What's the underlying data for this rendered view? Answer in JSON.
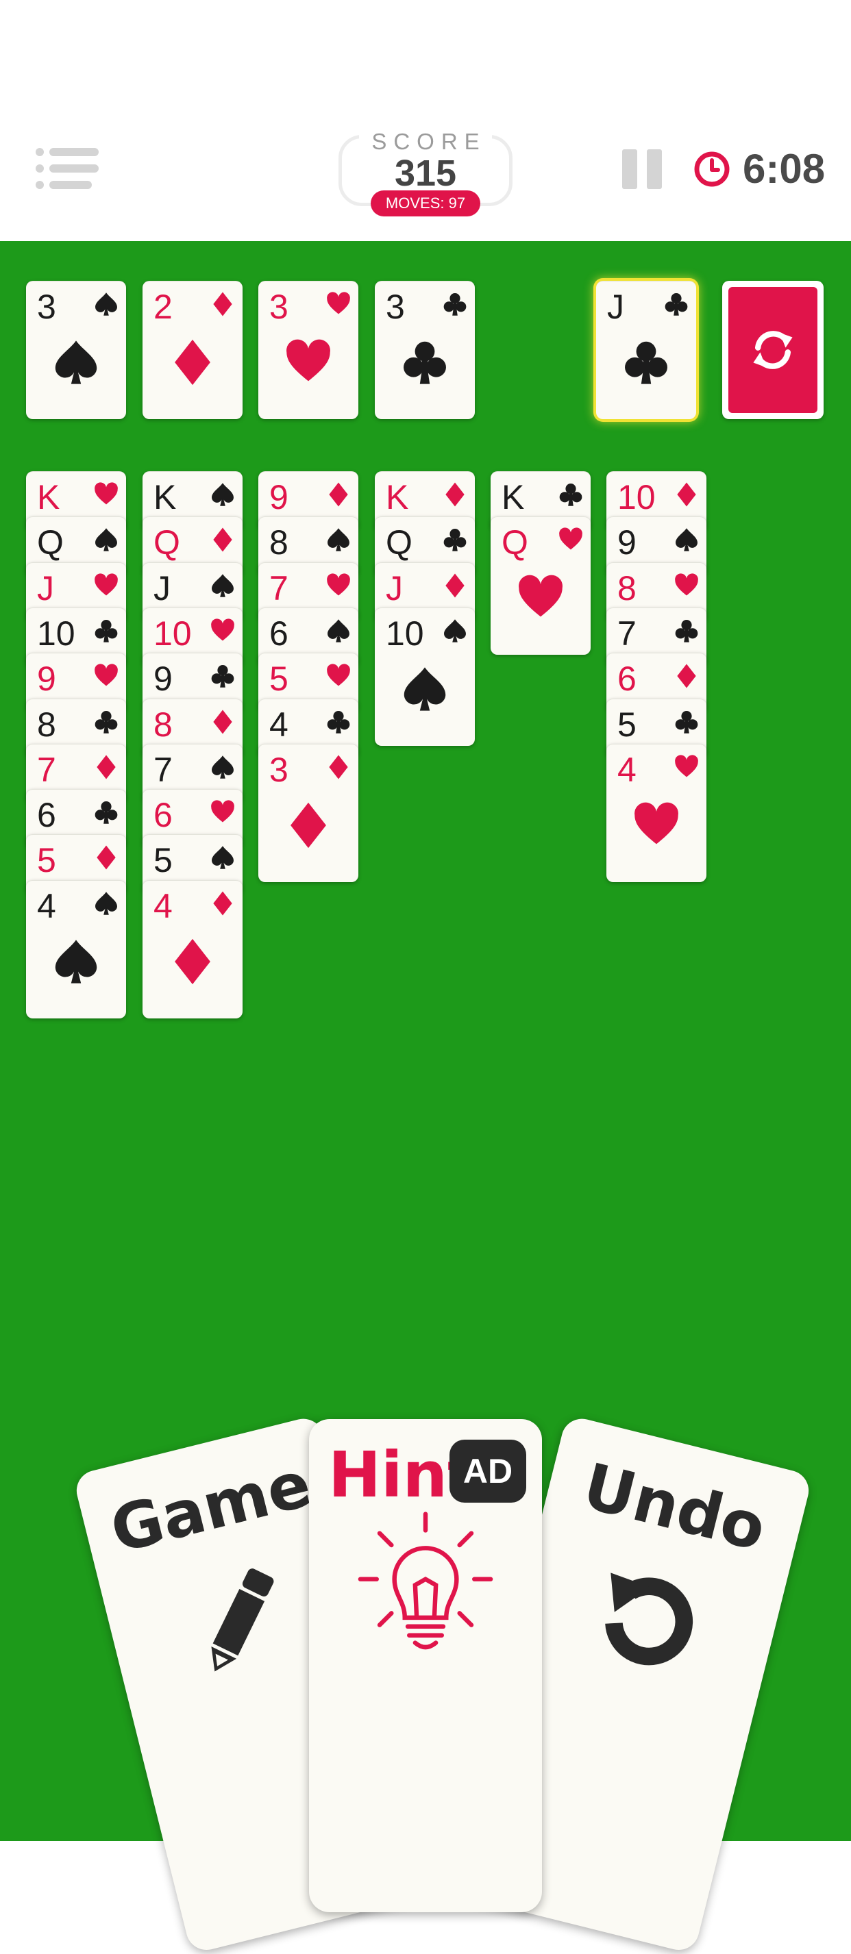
{
  "header": {
    "score_label": "SCORE",
    "score_value": "315",
    "moves_label": "MOVES: 97",
    "time": "6:08",
    "menu_icon": "menu-icon",
    "pause_icon": "pause-icon",
    "clock_icon": "clock-icon"
  },
  "colors": {
    "table": "#1d9a1a",
    "red": "#e0144a",
    "black": "#1c1c1c",
    "card": "#fbfaf4"
  },
  "foundations": [
    {
      "rank": "3",
      "suit": "spade"
    },
    {
      "rank": "2",
      "suit": "diamond"
    },
    {
      "rank": "3",
      "suit": "heart"
    },
    {
      "rank": "3",
      "suit": "club"
    }
  ],
  "waste": {
    "rank": "J",
    "suit": "club",
    "highlighted": true
  },
  "stock": {
    "icon": "refresh-icon"
  },
  "tableau": [
    [
      {
        "rank": "K",
        "suit": "heart"
      },
      {
        "rank": "Q",
        "suit": "spade"
      },
      {
        "rank": "J",
        "suit": "heart"
      },
      {
        "rank": "10",
        "suit": "club"
      },
      {
        "rank": "9",
        "suit": "heart"
      },
      {
        "rank": "8",
        "suit": "club"
      },
      {
        "rank": "7",
        "suit": "diamond"
      },
      {
        "rank": "6",
        "suit": "club"
      },
      {
        "rank": "5",
        "suit": "diamond"
      },
      {
        "rank": "4",
        "suit": "spade"
      }
    ],
    [
      {
        "rank": "K",
        "suit": "spade"
      },
      {
        "rank": "Q",
        "suit": "diamond"
      },
      {
        "rank": "J",
        "suit": "spade"
      },
      {
        "rank": "10",
        "suit": "heart"
      },
      {
        "rank": "9",
        "suit": "club"
      },
      {
        "rank": "8",
        "suit": "diamond"
      },
      {
        "rank": "7",
        "suit": "spade"
      },
      {
        "rank": "6",
        "suit": "heart"
      },
      {
        "rank": "5",
        "suit": "spade"
      },
      {
        "rank": "4",
        "suit": "diamond"
      }
    ],
    [
      {
        "rank": "9",
        "suit": "diamond"
      },
      {
        "rank": "8",
        "suit": "spade"
      },
      {
        "rank": "7",
        "suit": "heart"
      },
      {
        "rank": "6",
        "suit": "spade"
      },
      {
        "rank": "5",
        "suit": "heart"
      },
      {
        "rank": "4",
        "suit": "club"
      },
      {
        "rank": "3",
        "suit": "diamond"
      }
    ],
    [
      {
        "rank": "K",
        "suit": "diamond"
      },
      {
        "rank": "Q",
        "suit": "club"
      },
      {
        "rank": "J",
        "suit": "diamond"
      },
      {
        "rank": "10",
        "suit": "spade"
      }
    ],
    [
      {
        "rank": "K",
        "suit": "club"
      },
      {
        "rank": "Q",
        "suit": "heart"
      }
    ],
    [
      {
        "rank": "10",
        "suit": "diamond"
      },
      {
        "rank": "9",
        "suit": "spade"
      },
      {
        "rank": "8",
        "suit": "heart"
      },
      {
        "rank": "7",
        "suit": "club"
      },
      {
        "rank": "6",
        "suit": "diamond"
      },
      {
        "rank": "5",
        "suit": "club"
      },
      {
        "rank": "4",
        "suit": "heart"
      }
    ]
  ],
  "buttons": {
    "game": {
      "label": "Game",
      "icon": "pencil-icon"
    },
    "hint": {
      "label": "Hint",
      "badge": "AD",
      "icon": "lightbulb-icon"
    },
    "undo": {
      "label": "Undo",
      "icon": "undo-icon"
    }
  }
}
